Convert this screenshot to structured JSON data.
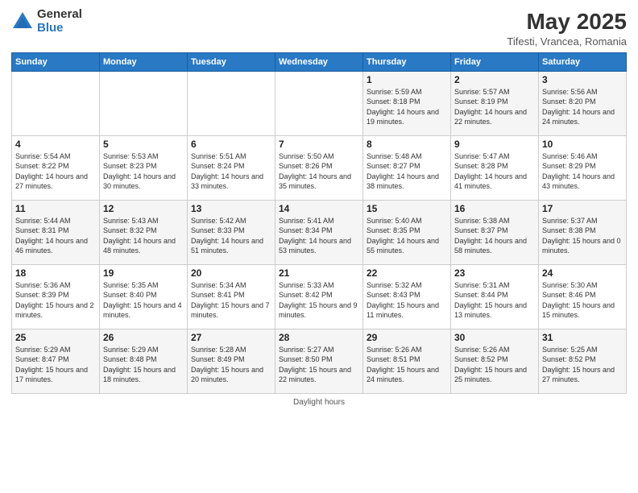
{
  "header": {
    "logo_general": "General",
    "logo_blue": "Blue",
    "month_year": "May 2025",
    "location": "Tifesti, Vrancea, Romania"
  },
  "days_of_week": [
    "Sunday",
    "Monday",
    "Tuesday",
    "Wednesday",
    "Thursday",
    "Friday",
    "Saturday"
  ],
  "weeks": [
    [
      {
        "day": "",
        "detail": ""
      },
      {
        "day": "",
        "detail": ""
      },
      {
        "day": "",
        "detail": ""
      },
      {
        "day": "",
        "detail": ""
      },
      {
        "day": "1",
        "detail": "Sunrise: 5:59 AM\nSunset: 8:18 PM\nDaylight: 14 hours\nand 19 minutes."
      },
      {
        "day": "2",
        "detail": "Sunrise: 5:57 AM\nSunset: 8:19 PM\nDaylight: 14 hours\nand 22 minutes."
      },
      {
        "day": "3",
        "detail": "Sunrise: 5:56 AM\nSunset: 8:20 PM\nDaylight: 14 hours\nand 24 minutes."
      }
    ],
    [
      {
        "day": "4",
        "detail": "Sunrise: 5:54 AM\nSunset: 8:22 PM\nDaylight: 14 hours\nand 27 minutes."
      },
      {
        "day": "5",
        "detail": "Sunrise: 5:53 AM\nSunset: 8:23 PM\nDaylight: 14 hours\nand 30 minutes."
      },
      {
        "day": "6",
        "detail": "Sunrise: 5:51 AM\nSunset: 8:24 PM\nDaylight: 14 hours\nand 33 minutes."
      },
      {
        "day": "7",
        "detail": "Sunrise: 5:50 AM\nSunset: 8:26 PM\nDaylight: 14 hours\nand 35 minutes."
      },
      {
        "day": "8",
        "detail": "Sunrise: 5:48 AM\nSunset: 8:27 PM\nDaylight: 14 hours\nand 38 minutes."
      },
      {
        "day": "9",
        "detail": "Sunrise: 5:47 AM\nSunset: 8:28 PM\nDaylight: 14 hours\nand 41 minutes."
      },
      {
        "day": "10",
        "detail": "Sunrise: 5:46 AM\nSunset: 8:29 PM\nDaylight: 14 hours\nand 43 minutes."
      }
    ],
    [
      {
        "day": "11",
        "detail": "Sunrise: 5:44 AM\nSunset: 8:31 PM\nDaylight: 14 hours\nand 46 minutes."
      },
      {
        "day": "12",
        "detail": "Sunrise: 5:43 AM\nSunset: 8:32 PM\nDaylight: 14 hours\nand 48 minutes."
      },
      {
        "day": "13",
        "detail": "Sunrise: 5:42 AM\nSunset: 8:33 PM\nDaylight: 14 hours\nand 51 minutes."
      },
      {
        "day": "14",
        "detail": "Sunrise: 5:41 AM\nSunset: 8:34 PM\nDaylight: 14 hours\nand 53 minutes."
      },
      {
        "day": "15",
        "detail": "Sunrise: 5:40 AM\nSunset: 8:35 PM\nDaylight: 14 hours\nand 55 minutes."
      },
      {
        "day": "16",
        "detail": "Sunrise: 5:38 AM\nSunset: 8:37 PM\nDaylight: 14 hours\nand 58 minutes."
      },
      {
        "day": "17",
        "detail": "Sunrise: 5:37 AM\nSunset: 8:38 PM\nDaylight: 15 hours\nand 0 minutes."
      }
    ],
    [
      {
        "day": "18",
        "detail": "Sunrise: 5:36 AM\nSunset: 8:39 PM\nDaylight: 15 hours\nand 2 minutes."
      },
      {
        "day": "19",
        "detail": "Sunrise: 5:35 AM\nSunset: 8:40 PM\nDaylight: 15 hours\nand 4 minutes."
      },
      {
        "day": "20",
        "detail": "Sunrise: 5:34 AM\nSunset: 8:41 PM\nDaylight: 15 hours\nand 7 minutes."
      },
      {
        "day": "21",
        "detail": "Sunrise: 5:33 AM\nSunset: 8:42 PM\nDaylight: 15 hours\nand 9 minutes."
      },
      {
        "day": "22",
        "detail": "Sunrise: 5:32 AM\nSunset: 8:43 PM\nDaylight: 15 hours\nand 11 minutes."
      },
      {
        "day": "23",
        "detail": "Sunrise: 5:31 AM\nSunset: 8:44 PM\nDaylight: 15 hours\nand 13 minutes."
      },
      {
        "day": "24",
        "detail": "Sunrise: 5:30 AM\nSunset: 8:46 PM\nDaylight: 15 hours\nand 15 minutes."
      }
    ],
    [
      {
        "day": "25",
        "detail": "Sunrise: 5:29 AM\nSunset: 8:47 PM\nDaylight: 15 hours\nand 17 minutes."
      },
      {
        "day": "26",
        "detail": "Sunrise: 5:29 AM\nSunset: 8:48 PM\nDaylight: 15 hours\nand 18 minutes."
      },
      {
        "day": "27",
        "detail": "Sunrise: 5:28 AM\nSunset: 8:49 PM\nDaylight: 15 hours\nand 20 minutes."
      },
      {
        "day": "28",
        "detail": "Sunrise: 5:27 AM\nSunset: 8:50 PM\nDaylight: 15 hours\nand 22 minutes."
      },
      {
        "day": "29",
        "detail": "Sunrise: 5:26 AM\nSunset: 8:51 PM\nDaylight: 15 hours\nand 24 minutes."
      },
      {
        "day": "30",
        "detail": "Sunrise: 5:26 AM\nSunset: 8:52 PM\nDaylight: 15 hours\nand 25 minutes."
      },
      {
        "day": "31",
        "detail": "Sunrise: 5:25 AM\nSunset: 8:52 PM\nDaylight: 15 hours\nand 27 minutes."
      }
    ]
  ],
  "footer": "Daylight hours"
}
